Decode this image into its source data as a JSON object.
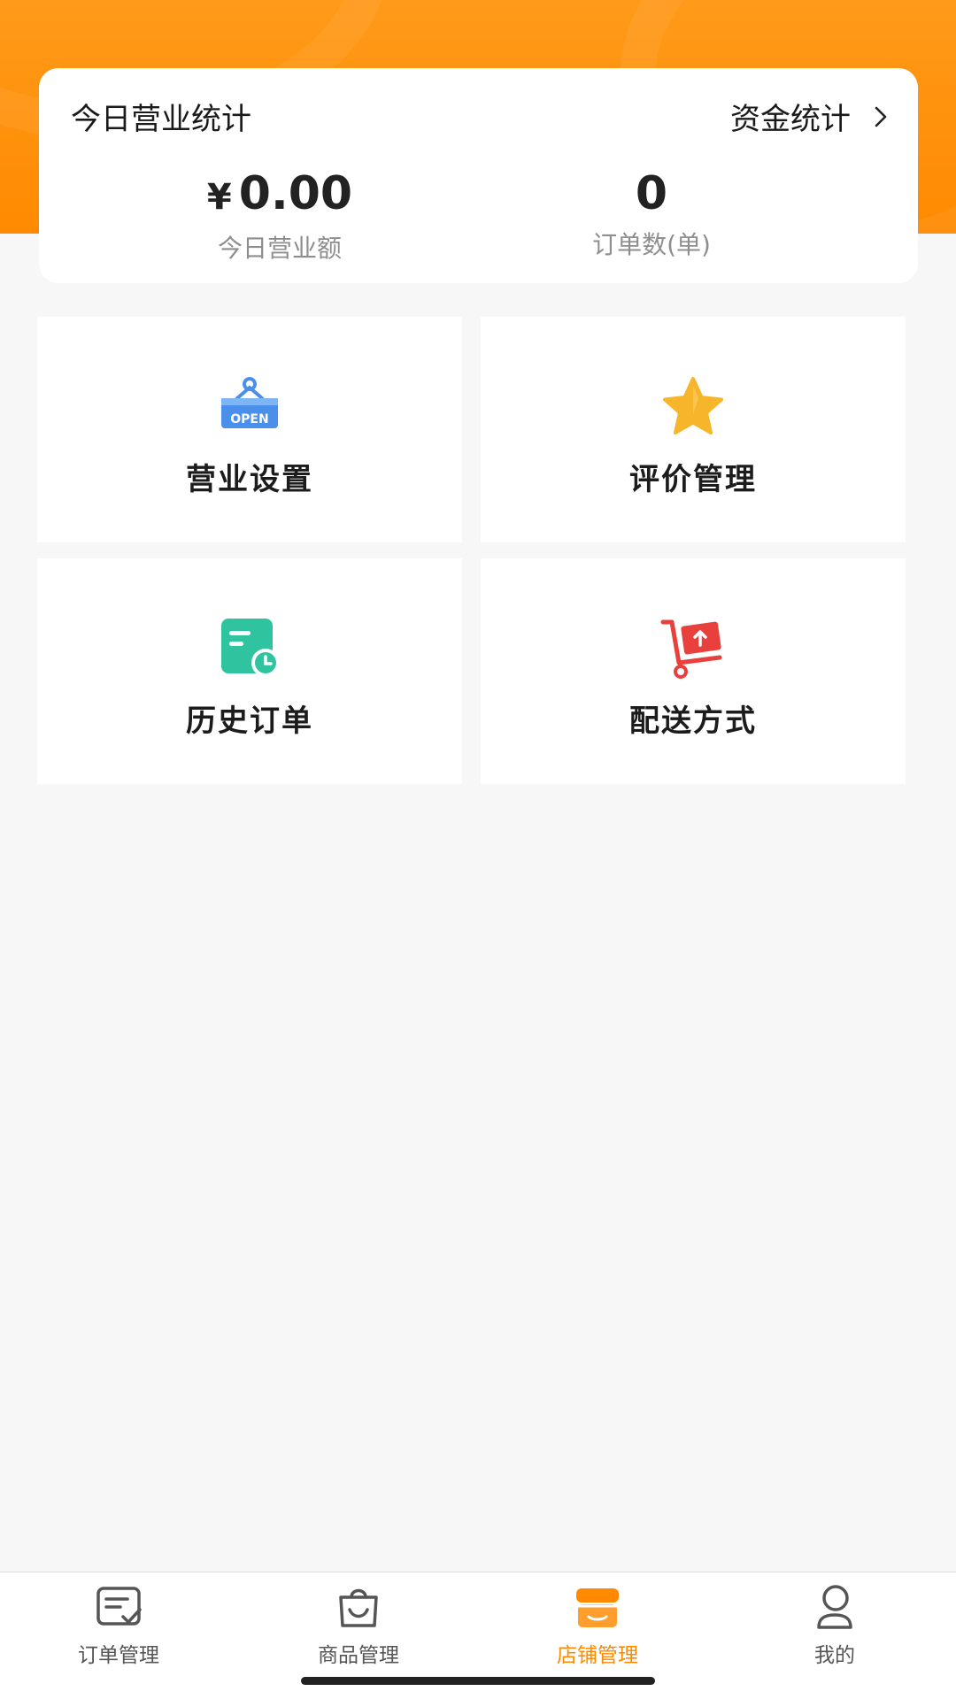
{
  "stats": {
    "title": "今日营业统计",
    "funds_link": "资金统计",
    "revenue": {
      "currency": "¥",
      "value": "0.00",
      "label": "今日营业额"
    },
    "orders": {
      "value": "0",
      "label": "订单数(单)"
    }
  },
  "tiles": [
    {
      "label": "营业设置",
      "icon": "open-sign-icon"
    },
    {
      "label": "评价管理",
      "icon": "star-icon"
    },
    {
      "label": "历史订单",
      "icon": "history-order-icon"
    },
    {
      "label": "配送方式",
      "icon": "delivery-cart-icon"
    }
  ],
  "open_sign_text": "OPEN",
  "tabbar": {
    "items": [
      {
        "label": "订单管理",
        "icon": "order-list-icon"
      },
      {
        "label": "商品管理",
        "icon": "shopping-bag-icon"
      },
      {
        "label": "店铺管理",
        "icon": "store-icon",
        "active": true
      },
      {
        "label": "我的",
        "icon": "user-icon"
      }
    ]
  },
  "colors": {
    "accent": "#ff8a00",
    "background": "#f7f7f7"
  }
}
